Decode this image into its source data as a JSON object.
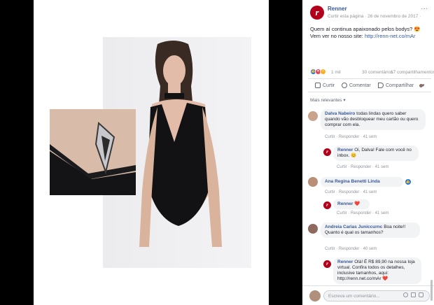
{
  "post": {
    "page_name": "Renner",
    "meta_text": "Curtir esta página · 26 de novembro de 2017 ·",
    "options_label": "...",
    "logo_letter": "r",
    "caption": "Quem aí continua apaixonado pelos bodys? 😍 Vem ver no nosso site:",
    "link": "http://renn-net.co/mAr",
    "reaction_count": "1 mil",
    "comments_count": "30 comentários",
    "shares_count": "17 compartilhamentos",
    "actions": [
      "Curtir",
      "Comentar",
      "Compartilhar"
    ]
  },
  "comments_sort": "Mais relevantes ▾",
  "comments": [
    {
      "author": "Dalva Nabeiro",
      "text": "todas lindas quero saber quando vão desbloquear meu cartão ou quero comprar com ela.",
      "actions": "Curtir · Responder · 41 sem"
    },
    {
      "author": "Renner",
      "text": "Oi, Dalva! Fale com você no inbox. 😊",
      "actions": "Curtir · Responder · 41 sem"
    },
    {
      "author": "Ana Regina Benetti Linda",
      "text": "",
      "actions": "Curtir · Responder · 41 sem"
    },
    {
      "author": "Renner",
      "text": "❤️",
      "actions": "Curtir · Responder · 41 sem"
    },
    {
      "author": "Andreia Carias Juniccurnc",
      "text": "Boa noite!! Quanto é qual os tamanhos?",
      "actions": "Curtir · Responder · 40 sem"
    },
    {
      "author": "Renner",
      "text": "Olá! É R$ 89,90 na nossa loja virtual. Confira todos os detalhes, inclusive tamanhos, aqui: http://renn.net.co/mAr ❤️",
      "actions": ""
    }
  ],
  "compose_placeholder": "Escreva um comentário...",
  "colors": {
    "link": "#385898",
    "brand": "#b3001b",
    "muted": "#90949c"
  }
}
